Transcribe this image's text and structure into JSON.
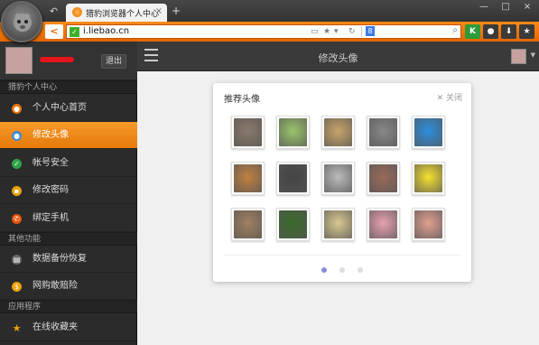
{
  "browser": {
    "tab_title": "猎豹浏览器个人中心",
    "tab_close": "×",
    "new_tab": "+",
    "url": "i.liebao.cn",
    "search_engine_badge": "8",
    "window_buttons": [
      "—",
      "□",
      "×"
    ],
    "toolbar_icons": [
      "K",
      "lock-icon",
      "download-icon",
      "star-icon"
    ]
  },
  "sidebar": {
    "logout_label": "退出",
    "sections": [
      {
        "title": "猎豹个人中心",
        "items": [
          {
            "label": "个人中心首页",
            "icon": "home-icon",
            "color": "#e8750a"
          },
          {
            "label": "修改头像",
            "icon": "user-icon",
            "color": "#3a88d8",
            "active": true
          },
          {
            "label": "帐号安全",
            "icon": "shield-icon",
            "color": "#2fa24a"
          },
          {
            "label": "修改密码",
            "icon": "lock-icon",
            "color": "#e8a20a"
          },
          {
            "label": "绑定手机",
            "icon": "phone-icon",
            "color": "#e8500a"
          }
        ]
      },
      {
        "title": "其他功能",
        "items": [
          {
            "label": "数据备份恢复",
            "icon": "backup-icon",
            "color": "#666"
          },
          {
            "label": "网购敢赔险",
            "icon": "coin-icon",
            "color": "#e8a20a"
          }
        ]
      },
      {
        "title": "应用程序",
        "items": [
          {
            "label": "在线收藏夹",
            "icon": "star-icon",
            "color": "#e8a20a"
          }
        ]
      }
    ]
  },
  "main": {
    "title": "修改头像"
  },
  "avatar_picker": {
    "title": "推荐头像",
    "close_label": "✕ 关闭",
    "avatars": [
      {
        "name": "monkey",
        "color": "#8a7a6a"
      },
      {
        "name": "frog",
        "color": "#9ac46a"
      },
      {
        "name": "blonde-girl",
        "color": "#c9a468"
      },
      {
        "name": "zebra",
        "color": "#888"
      },
      {
        "name": "doraemon",
        "color": "#2c8ee0"
      },
      {
        "name": "camel",
        "color": "#c08040"
      },
      {
        "name": "man-portrait",
        "color": "#444"
      },
      {
        "name": "bw-figure",
        "color": "#bbb"
      },
      {
        "name": "woman-profile",
        "color": "#9a6a5a"
      },
      {
        "name": "spongebob",
        "color": "#f4e030"
      },
      {
        "name": "tiger-cub",
        "color": "#a08060"
      },
      {
        "name": "green-cat",
        "color": "#3a6a2a"
      },
      {
        "name": "bottles",
        "color": "#d8c890"
      },
      {
        "name": "pink-flower",
        "color": "#e8a0b0"
      },
      {
        "name": "cute-girl",
        "color": "#e0a090"
      }
    ],
    "pagination": {
      "pages": 3,
      "current": 1
    }
  }
}
